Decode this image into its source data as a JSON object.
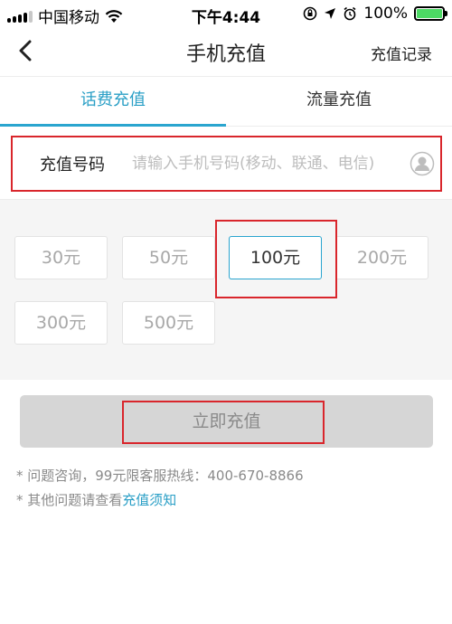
{
  "status_bar": {
    "carrier": "中国移动",
    "time": "下午4:44",
    "battery": "100%",
    "battery_level": 1.0,
    "signal_bars": 4
  },
  "nav": {
    "title": "手机充值",
    "right_label": "充值记录",
    "back_icon": "chevron-left-icon"
  },
  "tabs": [
    {
      "label": "话费充值",
      "active": true
    },
    {
      "label": "流量充值",
      "active": false
    }
  ],
  "phone": {
    "label": "充值号码",
    "placeholder": "请输入手机号码(移动、联通、电信)",
    "value": ""
  },
  "amounts": [
    {
      "label": "30元",
      "selected": false
    },
    {
      "label": "50元",
      "selected": false
    },
    {
      "label": "100元",
      "selected": true
    },
    {
      "label": "200元",
      "selected": false
    },
    {
      "label": "300元",
      "selected": false
    },
    {
      "label": "500元",
      "selected": false
    }
  ],
  "submit_label": "立即充值",
  "notes": {
    "line1": "* 问题咨询，99元限客服热线：400-670-8866",
    "line2_prefix": "* 其他问题请查看",
    "line2_link": "充值须知"
  },
  "colors": {
    "accent": "#2aa5cf",
    "highlight": "#d9262c",
    "battery": "#4cd964"
  }
}
